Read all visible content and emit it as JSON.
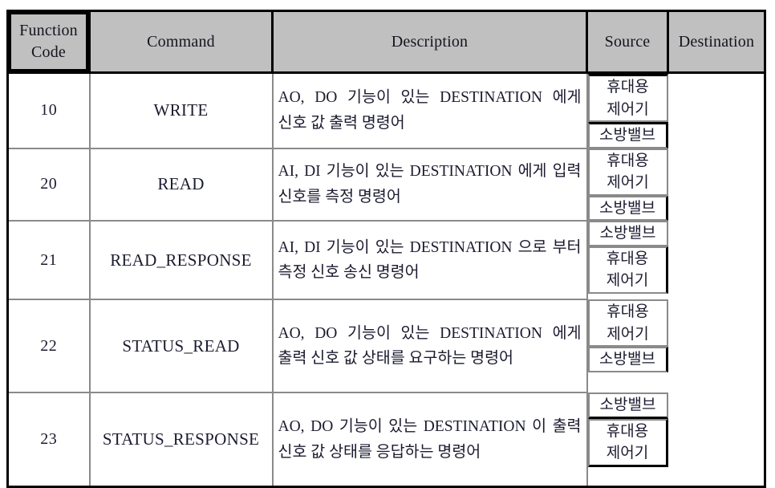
{
  "table": {
    "headers": [
      {
        "id": "function-code",
        "label": "Function\nCode"
      },
      {
        "id": "command",
        "label": "Command"
      },
      {
        "id": "description",
        "label": "Description"
      },
      {
        "id": "source",
        "label": "Source"
      },
      {
        "id": "destination",
        "label": "Destination"
      }
    ],
    "rows": [
      {
        "code": "10",
        "command": "WRITE",
        "description": "AO, DO 기능이 있는 DESTINATION 에게 신호 값 출력 명령어",
        "source": "휴대용\n제어기",
        "destination": "소방밸브"
      },
      {
        "code": "20",
        "command": "READ",
        "description": "AI, DI 기능이 있는 DESTINATION 에게 입력 신호를 측정 명령어",
        "source": "휴대용\n제어기",
        "destination": "소방밸브"
      },
      {
        "code": "21",
        "command": "READ_RESPONSE",
        "description": "AI, DI 기능이 있는 DESTINATION 으로 부터 측정 신호 송신 명령어",
        "source": "소방밸브",
        "destination": "휴대용\n제어기"
      },
      {
        "code": "22",
        "command": "STATUS_READ",
        "description": "AO, DO 기능이 있는 DESTINATION 에게 출력 신호 값 상태를 요구하는 명령어",
        "source": "휴대용\n제어기",
        "destination": "소방밸브"
      },
      {
        "code": "23",
        "command": "STATUS_RESPONSE",
        "description": "AO, DO 기능이 있는 DESTINATION 이 출력 신호 값 상태를 응답하는 명령어",
        "source": "소방밸브",
        "destination": "휴대용\n제어기"
      }
    ]
  },
  "colors": {
    "header_background": "#c0c0c0",
    "outer_border": "#000000",
    "inner_border": "#8a8a8a",
    "text": "#1b1b30",
    "page_background": "#ffffff"
  }
}
